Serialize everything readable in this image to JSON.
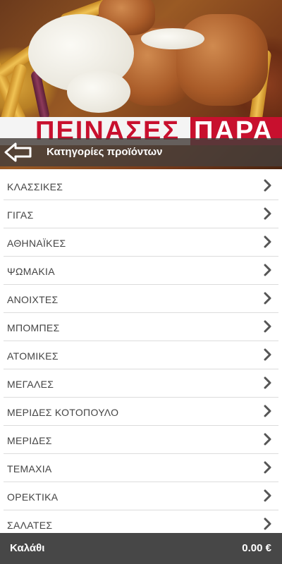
{
  "banner": {
    "promo_left": "ΠΕΙΝΑΣΕΣ ;",
    "promo_right": "ΠΑΡΑ"
  },
  "header": {
    "back_icon": "arrow-left-icon",
    "title": "Κατηγορίες προϊόντων"
  },
  "categories": [
    {
      "label": "ΚΛΑΣΣΙΚΕΣ"
    },
    {
      "label": "ΓΙΓΑΣ"
    },
    {
      "label": "ΑΘΗΝΑΪΚΕΣ"
    },
    {
      "label": "ΨΩΜΑΚΙΑ"
    },
    {
      "label": "ΑΝΟΙΧΤΕΣ"
    },
    {
      "label": "ΜΠΟΜΠΕΣ"
    },
    {
      "label": "ΑΤΟΜΙΚΕΣ"
    },
    {
      "label": "ΜΕΓΑΛΕΣ"
    },
    {
      "label": "ΜΕΡΙΔΕΣ ΚΟΤΟΠΟΥΛΟ"
    },
    {
      "label": "ΜΕΡΙΔΕΣ"
    },
    {
      "label": "ΤΕΜΑΧΙΑ"
    },
    {
      "label": "ΟΡΕΚΤΙΚΑ"
    },
    {
      "label": "ΣΑΛΑΤΕΣ"
    }
  ],
  "cart": {
    "label": "Καλάθι",
    "total": "0.00 €"
  },
  "colors": {
    "brand_red": "#c8102e",
    "header_overlay": "#463e3a",
    "cart_bar": "#474747",
    "chevron": "#555555"
  }
}
